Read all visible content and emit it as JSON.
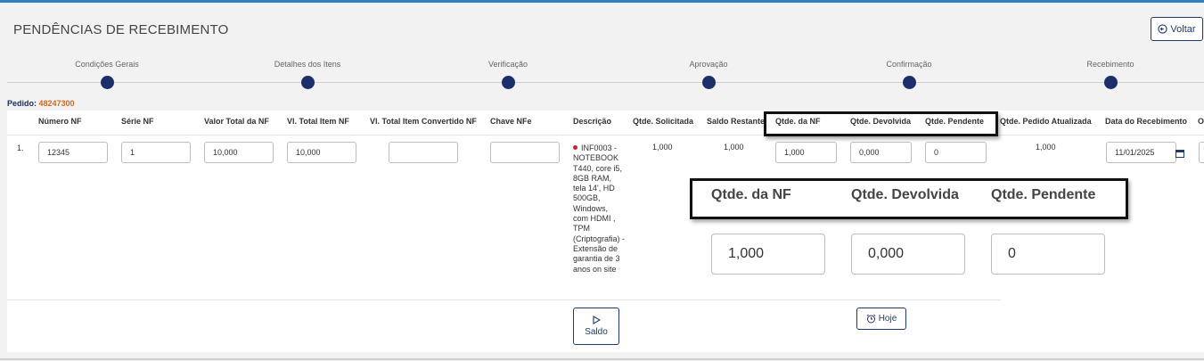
{
  "page": {
    "title": "PENDÊNCIAS DE RECEBIMENTO",
    "back_label": "Voltar"
  },
  "steps": [
    "Condições Gerais",
    "Detalhes dos Itens",
    "Verificação",
    "Aprovação",
    "Confirmação",
    "Recebimento"
  ],
  "pedido": {
    "label": "Pedido:",
    "number": "48247300"
  },
  "table": {
    "headers": {
      "numero_nf": "Número NF",
      "serie_nf": "Série NF",
      "valor_total_nf": "Valor Total da NF",
      "vl_total_item_nf": "Vl. Total Item NF",
      "vl_total_item_convertido": "Vl. Total Item Convertido NF",
      "chave_nfe": "Chave NFe",
      "descricao": "Descrição",
      "qtde_solicitada": "Qtde. Solicitada",
      "saldo_restante": "Saldo Restante",
      "qtde_nf": "Qtde. da NF",
      "qtde_devolvida": "Qtde. Devolvida",
      "qtde_pendente": "Qtde. Pendente",
      "qtde_pedido_atualizada": "Qtde. Pedido Atualizada",
      "data_recebimento": "Data do Recebimento",
      "overflow": "O"
    },
    "row": {
      "index": "1.",
      "numero_nf": "12345",
      "serie_nf": "1",
      "valor_total_nf": "10,000",
      "vl_total_item_nf": "10,000",
      "vl_total_item_convertido": "",
      "chave_nfe": "",
      "descricao": "INF0003 - NOTEBOOK T440, core i5, 8GB RAM, tela 14', HD 500GB, Windows, com HDMI , TPM (Criptografia) - Extensão de garantia de 3 anos on site",
      "qtde_solicitada": "1,000",
      "saldo_restante": "1,000",
      "qtde_nf": "1,000",
      "qtde_devolvida": "0,000",
      "qtde_pendente": "0",
      "qtde_pedido_atualizada": "1,000",
      "data_recebimento": "11/01/2025"
    },
    "saldo_label": "Saldo",
    "hoje_label": "Hoje"
  },
  "zoom": {
    "qtde_nf_label": "Qtde. da NF",
    "qtde_devolvida_label": "Qtde. Devolvida",
    "qtde_pendente_label": "Qtde. Pendente",
    "qtde_nf": "1,000",
    "qtde_devolvida": "0,000",
    "qtde_pendente": "0"
  },
  "colors": {
    "accent": "#1c2f6b",
    "pedido_number": "#d2691e",
    "status_dot": "#c62828",
    "topbar": "#2d7fc1"
  }
}
